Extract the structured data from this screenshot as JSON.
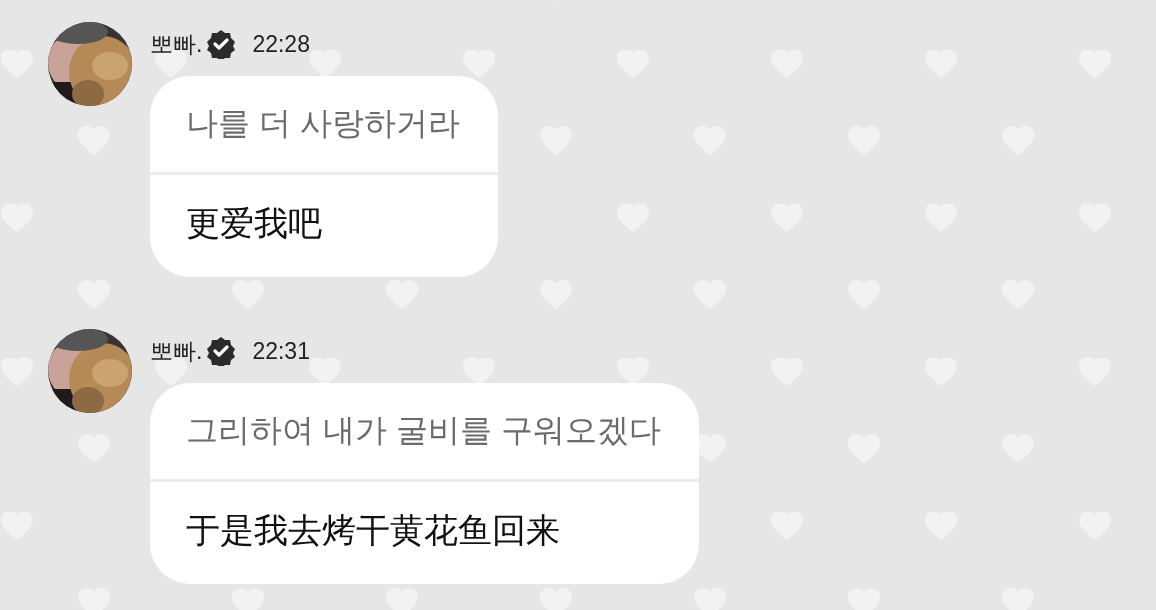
{
  "messages": [
    {
      "sender": "뽀빠.",
      "verified": true,
      "time": "22:28",
      "original": "나를 더 사랑하거라",
      "translation": "更爱我吧"
    },
    {
      "sender": "뽀빠.",
      "verified": true,
      "time": "22:31",
      "original": "그리하여 내가 굴비를 구워오겠다",
      "translation": "于是我去烤干黄花鱼回来"
    }
  ]
}
